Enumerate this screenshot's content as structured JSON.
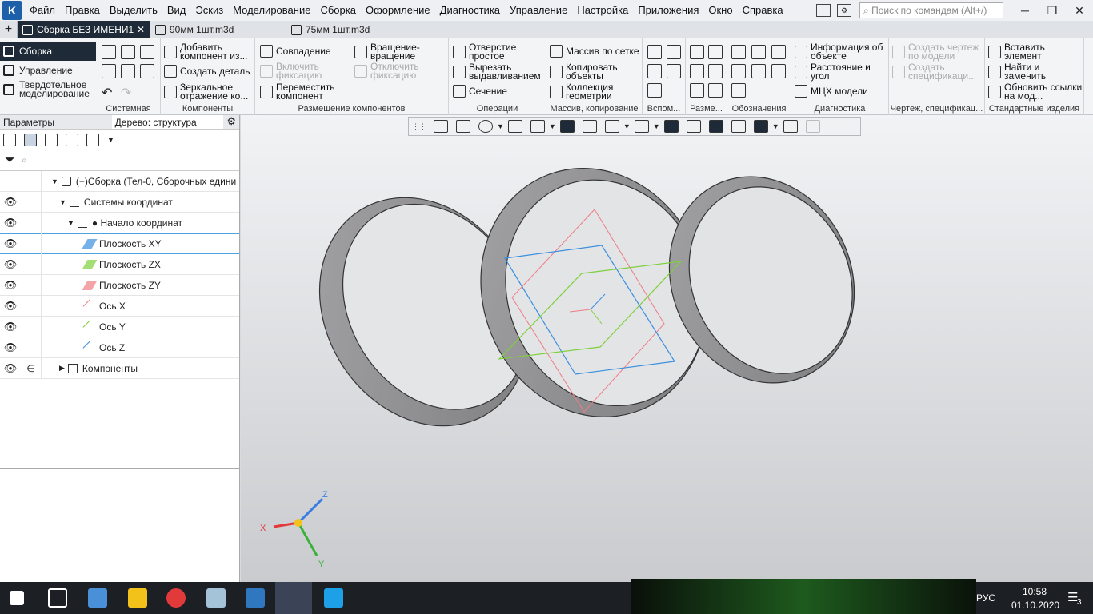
{
  "app": {
    "logo_letter": "K",
    "menu": [
      "Файл",
      "Правка",
      "Выделить",
      "Вид",
      "Эскиз",
      "Моделирование",
      "Сборка",
      "Оформление",
      "Диагностика",
      "Управление",
      "Настройка",
      "Приложения",
      "Окно",
      "Справка"
    ],
    "search_placeholder": "Поиск по командам (Alt+/)"
  },
  "doc_tabs": [
    {
      "label": "Сборка БЕЗ ИМЕНИ1",
      "active": true,
      "close": "✕"
    },
    {
      "label": "90мм 1шт.m3d",
      "active": false
    },
    {
      "label": "75мм 1шт.m3d",
      "active": false
    }
  ],
  "ribbon": {
    "modes": [
      "Сборка",
      "Управление",
      "Твердотельное моделирование"
    ],
    "groups": {
      "sistemnaya": "Системная",
      "komponenty": "Компоненты",
      "razmeshchenie": "Размещение компонентов",
      "operatsii": "Операции",
      "massiv": "Массив, копирование",
      "vspom": "Вспом...",
      "razme": "Разме...",
      "oboznacheniya": "Обозначения",
      "diagnostika": "Диагностика",
      "chertezh": "Чертеж, спецификац...",
      "standart": "Стандартные изделия"
    },
    "buttons": {
      "add_component": "Добавить компонент из...",
      "create_part": "Создать деталь",
      "mirror": "Зеркальное отражение ко...",
      "coincidence": "Совпадение",
      "enable_fix": "Включить фиксацию",
      "move_component": "Переместить компонент",
      "rotation": "Вращение-вращение",
      "disable_fix": "Отключить фиксацию",
      "simple_hole": "Отверстие простое",
      "cut_extrude": "Вырезать выдавливанием",
      "section": "Сечение",
      "grid_array": "Массив по сетке",
      "copy_objects": "Копировать объекты",
      "geom_collection": "Коллекция геометрии",
      "object_info": "Информация об объекте",
      "distance_angle": "Расстояние и угол",
      "mcx": "МЦХ модели",
      "create_drawing": "Создать чертеж по модели",
      "create_spec": "Создать спецификаци...",
      "insert_element": "Вставить элемент",
      "find_replace": "Найти и заменить",
      "update_links": "Обновить ссылки на мод..."
    }
  },
  "panel": {
    "tabs": [
      "Параметры",
      "Дерево: структура"
    ],
    "tree": [
      {
        "label": "(−)Сборка (Тел-0, Сборочных едини",
        "indent": 0
      },
      {
        "label": "Системы координат",
        "indent": 1
      },
      {
        "label": "● Начало координат",
        "indent": 2
      },
      {
        "label": "Плоскость XY",
        "indent": 3,
        "color": "#3a8fe0",
        "selected": true
      },
      {
        "label": "Плоскость ZX",
        "indent": 3,
        "color": "#7ed03b"
      },
      {
        "label": "Плоскость ZY",
        "indent": 3,
        "color": "#ef7c85"
      },
      {
        "label": "Ось X",
        "indent": 3,
        "color": "#ef7c85"
      },
      {
        "label": "Ось Y",
        "indent": 3,
        "color": "#7ed03b"
      },
      {
        "label": "Ось Z",
        "indent": 3,
        "color": "#3a8fe0"
      },
      {
        "label": "Компоненты",
        "indent": 1
      }
    ]
  },
  "triad": {
    "x": "X",
    "y": "Y",
    "z": "Z"
  },
  "tray": {
    "lang": "РУС",
    "time": "10:58",
    "date": "01.10.2020",
    "notif": "3"
  },
  "colors": {
    "accent": "#1f2a38",
    "ring": "#8e8e90",
    "blue": "#3a8fe0",
    "green": "#7ed03b",
    "red": "#ef7c85"
  }
}
